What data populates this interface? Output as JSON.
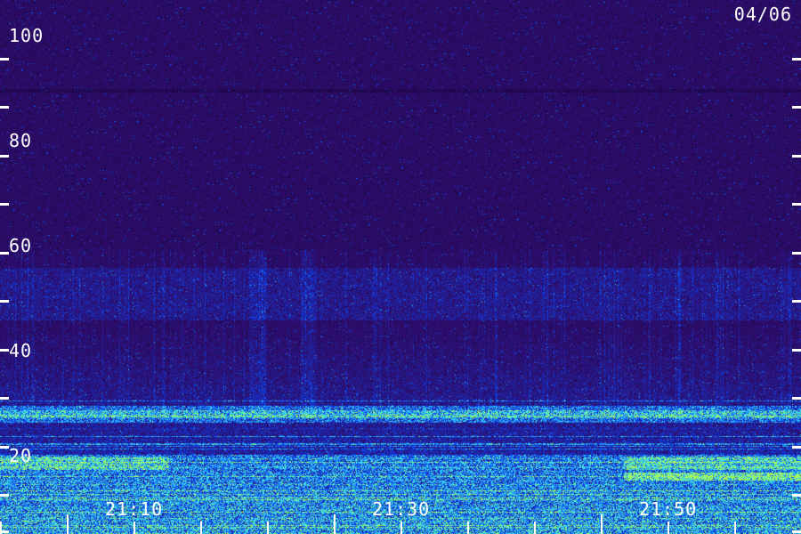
{
  "date": "04/06",
  "y_axis": {
    "min": 0,
    "max": 110,
    "labels": [
      "100",
      "80",
      "60",
      "40",
      "20"
    ],
    "label_values": [
      100,
      80,
      60,
      40,
      20
    ],
    "tick_values": [
      0,
      10,
      20,
      30,
      40,
      50,
      60,
      70,
      80,
      90,
      100
    ]
  },
  "x_axis": {
    "labels": [
      "21:10",
      "21:30",
      "21:50"
    ],
    "label_minutes": [
      10,
      30,
      50
    ],
    "start_minute": 5,
    "end_minute": 65,
    "minor_tick_step_minutes": 5
  },
  "colors": {
    "background": "#1e0a4a",
    "noise": "#3a20c0",
    "band": "#2040ff",
    "bright": "#40e8ff",
    "hot": "#c0ff40",
    "text": "#ffffff"
  }
}
